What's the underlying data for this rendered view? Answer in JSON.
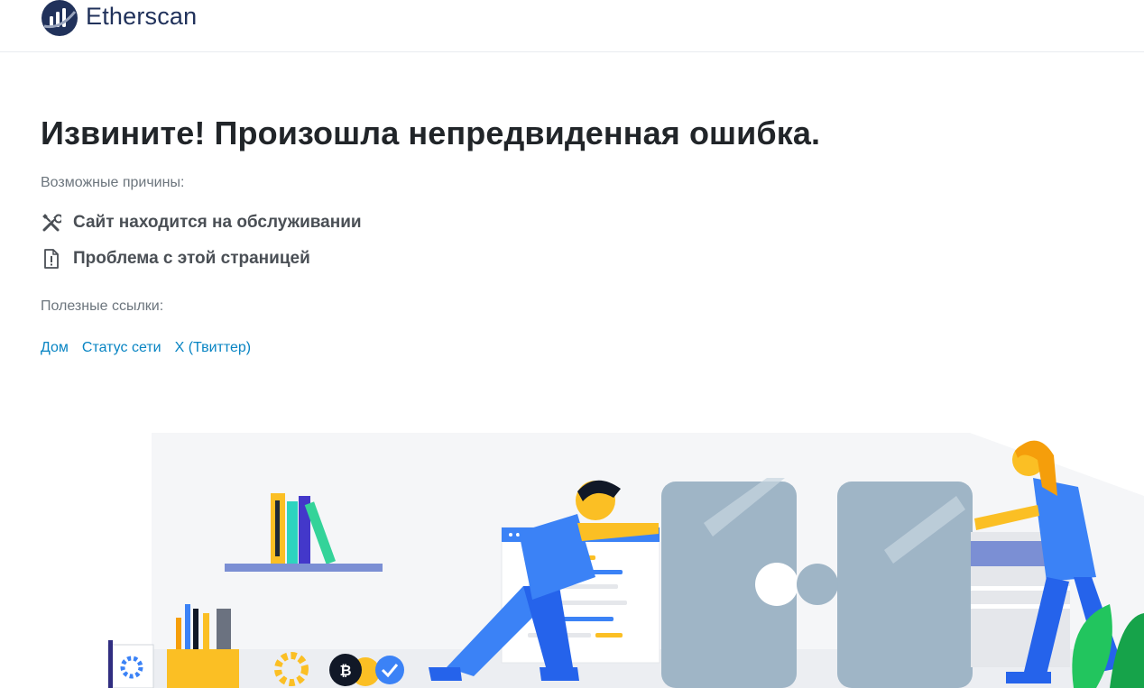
{
  "header": {
    "brand": "Etherscan",
    "logo_icon": "etherscan-logo-icon"
  },
  "main": {
    "title": "Извините! Произошла непредвиденная ошибка.",
    "reasons_heading": "Возможные причины:",
    "reasons": [
      {
        "label": "Сайт находится на обслуживании",
        "icon": "tools-icon"
      },
      {
        "label": "Проблема с этой страницей",
        "icon": "file-exclamation-icon"
      }
    ],
    "links_heading": "Полезные ссылки:",
    "links": [
      {
        "label": "Дом"
      },
      {
        "label": "Статус сети"
      },
      {
        "label": "X (Твиттер)"
      }
    ]
  },
  "colors": {
    "brand_navy": "#21325b",
    "link_blue": "#0784c3",
    "accent_blue": "#3b82f6",
    "accent_yellow": "#fbbf24"
  }
}
